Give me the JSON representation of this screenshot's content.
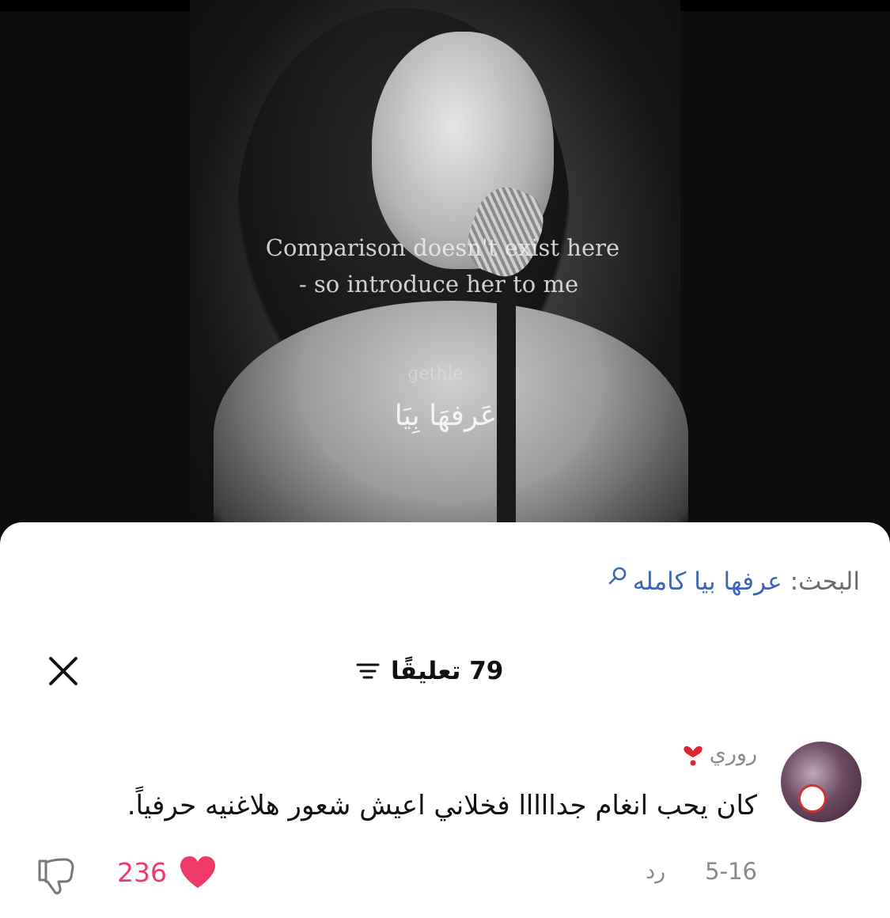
{
  "video": {
    "caption_line_1": "Comparison doesn't exist here",
    "caption_line_2": "- so introduce her to me",
    "watermark": "gethle",
    "arabic_title": "عَرفهَا بِيَا"
  },
  "search": {
    "label": "البحث",
    "separator": ":",
    "query": "عرفها بيا كامله",
    "icon": "search-icon"
  },
  "comments": {
    "count_label": "79 تعليقًا",
    "filter_icon": "filter-icon",
    "close_icon": "close-icon",
    "items": [
      {
        "username": "روري",
        "username_emoji": "heart-exclamation-emoji",
        "text": "كان يحب انغام جدااااا فخلاني اعيش شعور هلاغنيه حرفياً.",
        "date": "5-16",
        "reply_label": "رد",
        "likes": "236",
        "like_icon": "heart-icon",
        "dislike_icon": "thumbs-down-icon"
      }
    ]
  },
  "colors": {
    "accent_link": "#3a67b5",
    "like_red": "#ee3a68",
    "muted_text": "#8a8a8a"
  }
}
